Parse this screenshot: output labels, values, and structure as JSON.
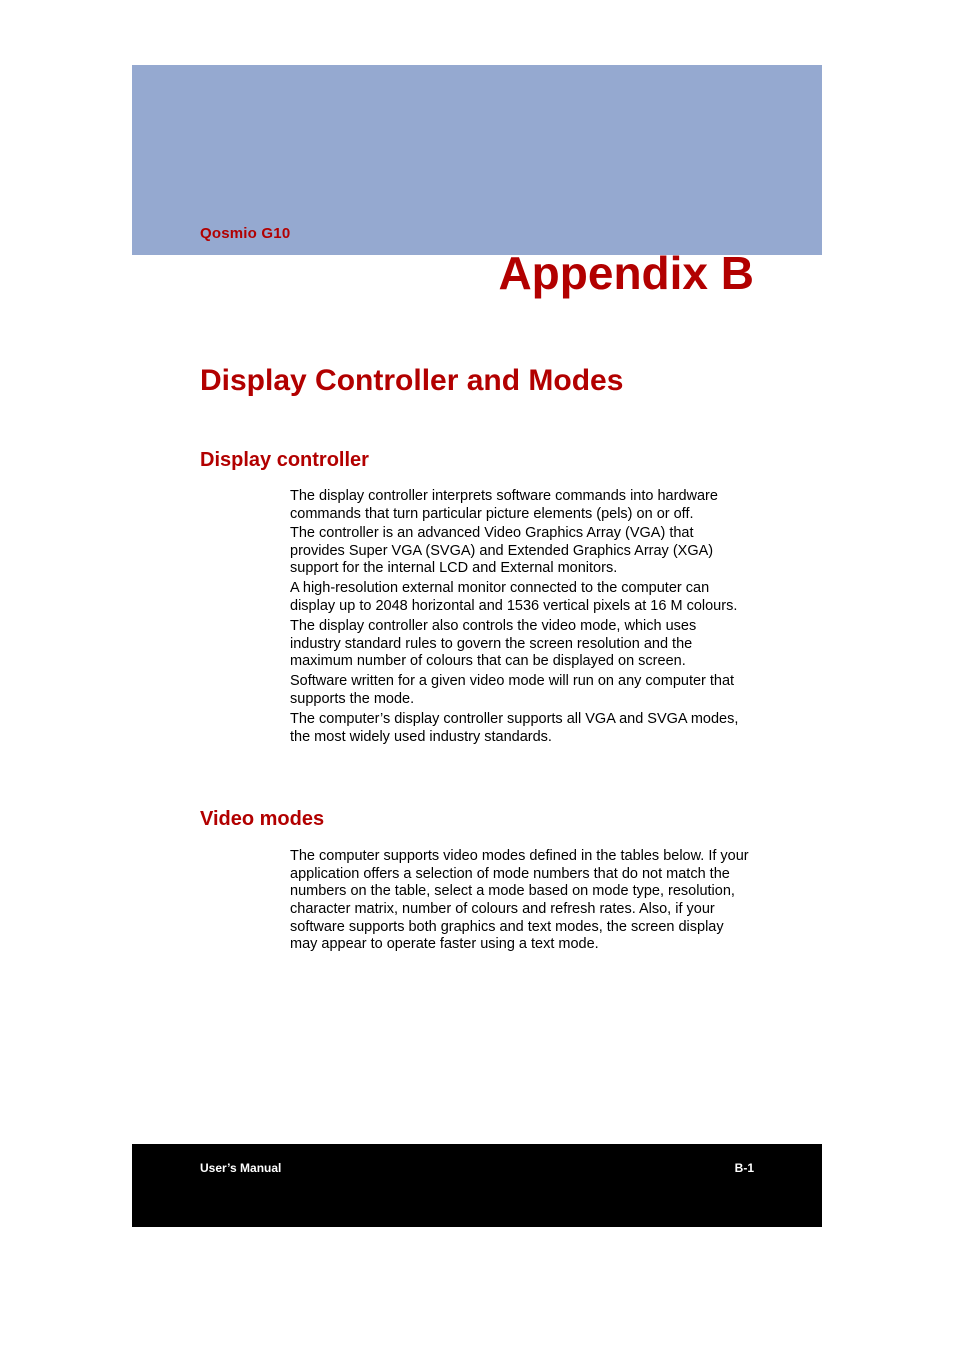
{
  "header": {
    "product": "Qosmio G10",
    "appendix": "Appendix B"
  },
  "title": "Display Controller and Modes",
  "sections": {
    "display_controller": {
      "heading": "Display controller",
      "paragraphs": [
        "The display controller interprets software commands into hardware commands that turn particular picture elements (pels) on or off.",
        "The controller is an advanced Video Graphics Array (VGA) that provides Super VGA (SVGA) and Extended Graphics Array (XGA) support for the internal LCD and External monitors.",
        "A high-resolution external monitor connected to the computer can display up to 2048 horizontal and 1536 vertical pixels at 16 M colours.",
        "The display controller also controls the video mode, which uses industry standard rules to govern the screen resolution and the maximum number of colours that can be displayed on screen.",
        "Software written for a given video mode will run on any computer that supports the mode.",
        "The computer’s display controller supports all VGA and SVGA modes, the most widely used industry standards."
      ]
    },
    "video_modes": {
      "heading": "Video modes",
      "paragraphs": [
        "The computer supports video modes defined in the tables below. If your application offers a selection of mode numbers that do not match the numbers on the table, select a mode based on mode type, resolution, character matrix, number of colours and refresh rates. Also, if your software supports both graphics and text modes, the screen display may appear to operate faster using a text mode."
      ]
    }
  },
  "footer": {
    "left": "User’s Manual",
    "right": "B-1"
  }
}
